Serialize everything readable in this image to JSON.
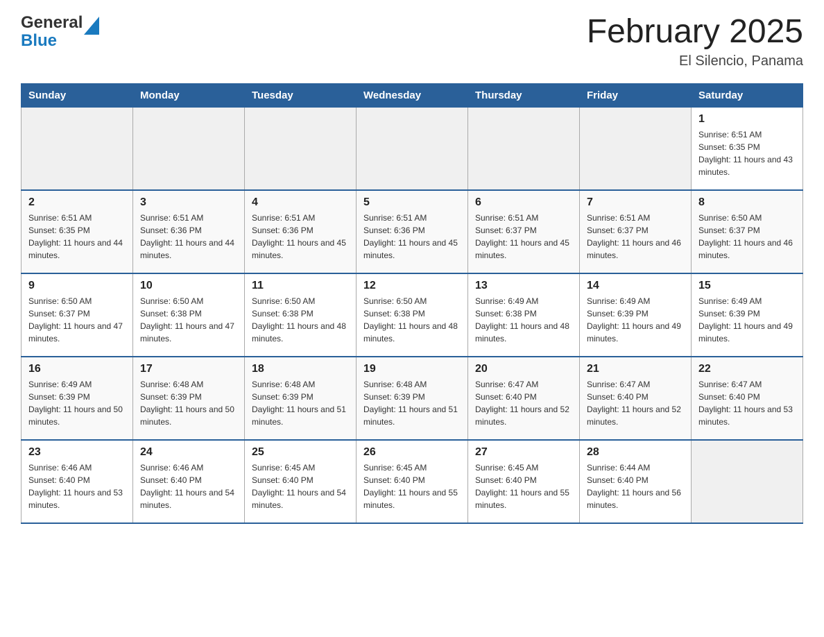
{
  "header": {
    "logo_line1": "General",
    "logo_line2": "Blue",
    "month_title": "February 2025",
    "location": "El Silencio, Panama"
  },
  "days_of_week": [
    "Sunday",
    "Monday",
    "Tuesday",
    "Wednesday",
    "Thursday",
    "Friday",
    "Saturday"
  ],
  "weeks": [
    [
      {
        "num": "",
        "info": ""
      },
      {
        "num": "",
        "info": ""
      },
      {
        "num": "",
        "info": ""
      },
      {
        "num": "",
        "info": ""
      },
      {
        "num": "",
        "info": ""
      },
      {
        "num": "",
        "info": ""
      },
      {
        "num": "1",
        "info": "Sunrise: 6:51 AM\nSunset: 6:35 PM\nDaylight: 11 hours and 43 minutes."
      }
    ],
    [
      {
        "num": "2",
        "info": "Sunrise: 6:51 AM\nSunset: 6:35 PM\nDaylight: 11 hours and 44 minutes."
      },
      {
        "num": "3",
        "info": "Sunrise: 6:51 AM\nSunset: 6:36 PM\nDaylight: 11 hours and 44 minutes."
      },
      {
        "num": "4",
        "info": "Sunrise: 6:51 AM\nSunset: 6:36 PM\nDaylight: 11 hours and 45 minutes."
      },
      {
        "num": "5",
        "info": "Sunrise: 6:51 AM\nSunset: 6:36 PM\nDaylight: 11 hours and 45 minutes."
      },
      {
        "num": "6",
        "info": "Sunrise: 6:51 AM\nSunset: 6:37 PM\nDaylight: 11 hours and 45 minutes."
      },
      {
        "num": "7",
        "info": "Sunrise: 6:51 AM\nSunset: 6:37 PM\nDaylight: 11 hours and 46 minutes."
      },
      {
        "num": "8",
        "info": "Sunrise: 6:50 AM\nSunset: 6:37 PM\nDaylight: 11 hours and 46 minutes."
      }
    ],
    [
      {
        "num": "9",
        "info": "Sunrise: 6:50 AM\nSunset: 6:37 PM\nDaylight: 11 hours and 47 minutes."
      },
      {
        "num": "10",
        "info": "Sunrise: 6:50 AM\nSunset: 6:38 PM\nDaylight: 11 hours and 47 minutes."
      },
      {
        "num": "11",
        "info": "Sunrise: 6:50 AM\nSunset: 6:38 PM\nDaylight: 11 hours and 48 minutes."
      },
      {
        "num": "12",
        "info": "Sunrise: 6:50 AM\nSunset: 6:38 PM\nDaylight: 11 hours and 48 minutes."
      },
      {
        "num": "13",
        "info": "Sunrise: 6:49 AM\nSunset: 6:38 PM\nDaylight: 11 hours and 48 minutes."
      },
      {
        "num": "14",
        "info": "Sunrise: 6:49 AM\nSunset: 6:39 PM\nDaylight: 11 hours and 49 minutes."
      },
      {
        "num": "15",
        "info": "Sunrise: 6:49 AM\nSunset: 6:39 PM\nDaylight: 11 hours and 49 minutes."
      }
    ],
    [
      {
        "num": "16",
        "info": "Sunrise: 6:49 AM\nSunset: 6:39 PM\nDaylight: 11 hours and 50 minutes."
      },
      {
        "num": "17",
        "info": "Sunrise: 6:48 AM\nSunset: 6:39 PM\nDaylight: 11 hours and 50 minutes."
      },
      {
        "num": "18",
        "info": "Sunrise: 6:48 AM\nSunset: 6:39 PM\nDaylight: 11 hours and 51 minutes."
      },
      {
        "num": "19",
        "info": "Sunrise: 6:48 AM\nSunset: 6:39 PM\nDaylight: 11 hours and 51 minutes."
      },
      {
        "num": "20",
        "info": "Sunrise: 6:47 AM\nSunset: 6:40 PM\nDaylight: 11 hours and 52 minutes."
      },
      {
        "num": "21",
        "info": "Sunrise: 6:47 AM\nSunset: 6:40 PM\nDaylight: 11 hours and 52 minutes."
      },
      {
        "num": "22",
        "info": "Sunrise: 6:47 AM\nSunset: 6:40 PM\nDaylight: 11 hours and 53 minutes."
      }
    ],
    [
      {
        "num": "23",
        "info": "Sunrise: 6:46 AM\nSunset: 6:40 PM\nDaylight: 11 hours and 53 minutes."
      },
      {
        "num": "24",
        "info": "Sunrise: 6:46 AM\nSunset: 6:40 PM\nDaylight: 11 hours and 54 minutes."
      },
      {
        "num": "25",
        "info": "Sunrise: 6:45 AM\nSunset: 6:40 PM\nDaylight: 11 hours and 54 minutes."
      },
      {
        "num": "26",
        "info": "Sunrise: 6:45 AM\nSunset: 6:40 PM\nDaylight: 11 hours and 55 minutes."
      },
      {
        "num": "27",
        "info": "Sunrise: 6:45 AM\nSunset: 6:40 PM\nDaylight: 11 hours and 55 minutes."
      },
      {
        "num": "28",
        "info": "Sunrise: 6:44 AM\nSunset: 6:40 PM\nDaylight: 11 hours and 56 minutes."
      },
      {
        "num": "",
        "info": ""
      }
    ]
  ]
}
